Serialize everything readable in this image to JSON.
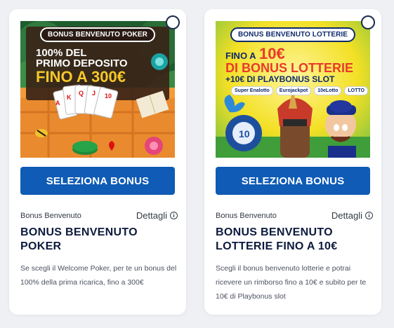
{
  "cards": [
    {
      "tag": "BONUS BENVENUTO POKER",
      "headline": {
        "line1": "100% DEL",
        "line2": "PRIMO DEPOSITO",
        "line3": "FINO A 300€"
      },
      "button_label": "SELEZIONA BONUS",
      "category": "Bonus Benvenuto",
      "details_label": "Dettagli",
      "title": "BONUS BENVENUTO POKER",
      "description": "Se scegli il Welcome Poker, per te un bonus del 100% della prima ricarica, fino a 300€"
    },
    {
      "tag": "BONUS BENVENUTO LOTTERIE",
      "headline": {
        "line1_prefix": "FINO A",
        "line1_amount": "10€",
        "line2": "DI BONUS LOTTERIE",
        "line3": "+10€ DI PLAYBONUS SLOT"
      },
      "logos": [
        "Super Enalotto",
        "Eurojackpot",
        "10eLotto",
        "LOTTO"
      ],
      "button_label": "SELEZIONA BONUS",
      "category": "Bonus Benvenuto",
      "details_label": "Dettagli",
      "title": "BONUS BENVENUTO LOTTERIE FINO A 10€",
      "description": "Scegli il bonus benvenuto lotterie e potrai ricevere un rimborso fino a 10€ e subito per te 10€ di Playbonus slot"
    }
  ],
  "colors": {
    "button": "#0f5bb5",
    "title": "#0c1a3d",
    "poker_gold": "#f6c829",
    "lotto_red": "#e83a2c",
    "lotto_navy": "#0d2a6b"
  },
  "icons": [
    "radio-icon",
    "info-icon"
  ]
}
